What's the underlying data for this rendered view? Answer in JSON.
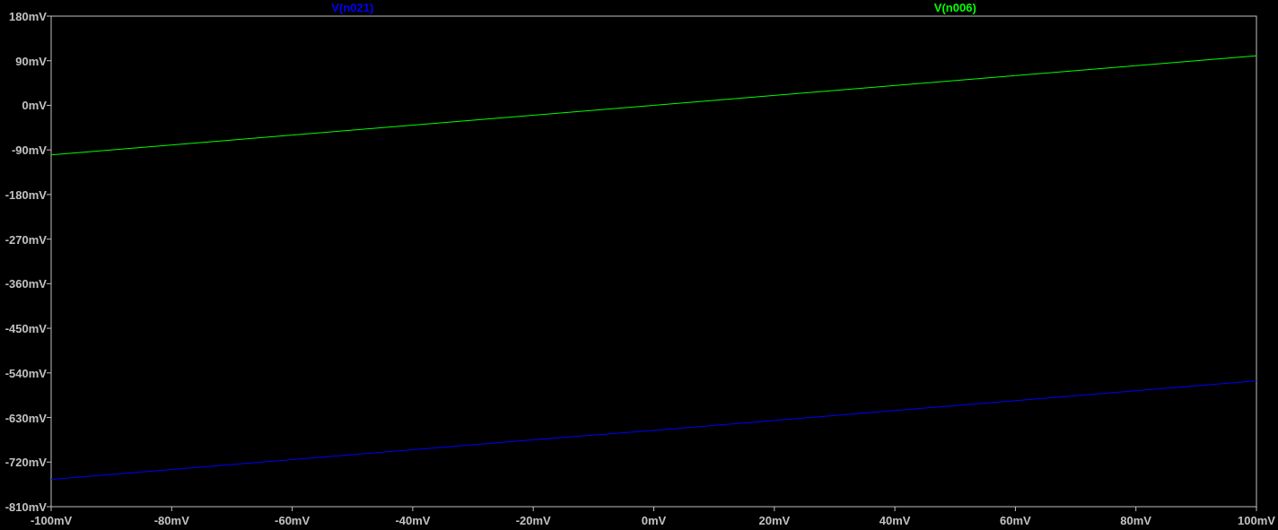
{
  "plot": {
    "chart_data": {
      "type": "line",
      "x": [
        -100,
        -80,
        -60,
        -40,
        -20,
        0,
        20,
        40,
        60,
        80,
        100
      ],
      "series": [
        {
          "name": "V(n021)",
          "color": "#0000ff",
          "values": [
            -755,
            -735,
            -715,
            -695,
            -675,
            -656,
            -636,
            -616,
            -596,
            -576,
            -556
          ]
        },
        {
          "name": "V(n006)",
          "color": "#00ff00",
          "values": [
            -100,
            -80,
            -60,
            -40,
            -20,
            0,
            20,
            40,
            60,
            80,
            100
          ]
        }
      ],
      "xlim": [
        -100,
        100
      ],
      "ylim": [
        -810,
        180
      ],
      "xticks": [
        {
          "value": -100,
          "label": "-100mV"
        },
        {
          "value": -80,
          "label": "-80mV"
        },
        {
          "value": -60,
          "label": "-60mV"
        },
        {
          "value": -40,
          "label": "-40mV"
        },
        {
          "value": -20,
          "label": "-20mV"
        },
        {
          "value": 0,
          "label": "0mV"
        },
        {
          "value": 20,
          "label": "20mV"
        },
        {
          "value": 40,
          "label": "40mV"
        },
        {
          "value": 60,
          "label": "60mV"
        },
        {
          "value": 80,
          "label": "80mV"
        },
        {
          "value": 100,
          "label": "100mV"
        }
      ],
      "yticks": [
        {
          "value": 180,
          "label": "180mV"
        },
        {
          "value": 90,
          "label": "90mV"
        },
        {
          "value": 0,
          "label": "0mV"
        },
        {
          "value": -90,
          "label": "-90mV"
        },
        {
          "value": -180,
          "label": "-180mV"
        },
        {
          "value": -270,
          "label": "-270mV"
        },
        {
          "value": -360,
          "label": "-360mV"
        },
        {
          "value": -450,
          "label": "-450mV"
        },
        {
          "value": -540,
          "label": "-540mV"
        },
        {
          "value": -630,
          "label": "-630mV"
        },
        {
          "value": -720,
          "label": "-720mV"
        },
        {
          "value": -810,
          "label": "-810mV"
        }
      ]
    }
  }
}
